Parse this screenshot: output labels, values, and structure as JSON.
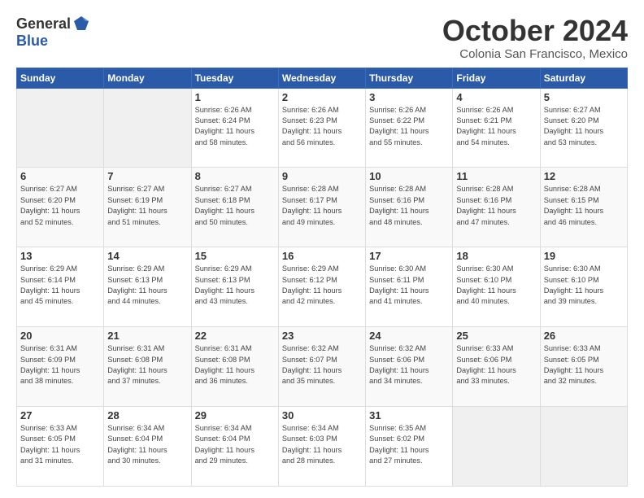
{
  "header": {
    "logo_general": "General",
    "logo_blue": "Blue",
    "month_title": "October 2024",
    "location": "Colonia San Francisco, Mexico"
  },
  "days_of_week": [
    "Sunday",
    "Monday",
    "Tuesday",
    "Wednesday",
    "Thursday",
    "Friday",
    "Saturday"
  ],
  "weeks": [
    [
      {
        "day": "",
        "info": ""
      },
      {
        "day": "",
        "info": ""
      },
      {
        "day": "1",
        "info": "Sunrise: 6:26 AM\nSunset: 6:24 PM\nDaylight: 11 hours\nand 58 minutes."
      },
      {
        "day": "2",
        "info": "Sunrise: 6:26 AM\nSunset: 6:23 PM\nDaylight: 11 hours\nand 56 minutes."
      },
      {
        "day": "3",
        "info": "Sunrise: 6:26 AM\nSunset: 6:22 PM\nDaylight: 11 hours\nand 55 minutes."
      },
      {
        "day": "4",
        "info": "Sunrise: 6:26 AM\nSunset: 6:21 PM\nDaylight: 11 hours\nand 54 minutes."
      },
      {
        "day": "5",
        "info": "Sunrise: 6:27 AM\nSunset: 6:20 PM\nDaylight: 11 hours\nand 53 minutes."
      }
    ],
    [
      {
        "day": "6",
        "info": "Sunrise: 6:27 AM\nSunset: 6:20 PM\nDaylight: 11 hours\nand 52 minutes."
      },
      {
        "day": "7",
        "info": "Sunrise: 6:27 AM\nSunset: 6:19 PM\nDaylight: 11 hours\nand 51 minutes."
      },
      {
        "day": "8",
        "info": "Sunrise: 6:27 AM\nSunset: 6:18 PM\nDaylight: 11 hours\nand 50 minutes."
      },
      {
        "day": "9",
        "info": "Sunrise: 6:28 AM\nSunset: 6:17 PM\nDaylight: 11 hours\nand 49 minutes."
      },
      {
        "day": "10",
        "info": "Sunrise: 6:28 AM\nSunset: 6:16 PM\nDaylight: 11 hours\nand 48 minutes."
      },
      {
        "day": "11",
        "info": "Sunrise: 6:28 AM\nSunset: 6:16 PM\nDaylight: 11 hours\nand 47 minutes."
      },
      {
        "day": "12",
        "info": "Sunrise: 6:28 AM\nSunset: 6:15 PM\nDaylight: 11 hours\nand 46 minutes."
      }
    ],
    [
      {
        "day": "13",
        "info": "Sunrise: 6:29 AM\nSunset: 6:14 PM\nDaylight: 11 hours\nand 45 minutes."
      },
      {
        "day": "14",
        "info": "Sunrise: 6:29 AM\nSunset: 6:13 PM\nDaylight: 11 hours\nand 44 minutes."
      },
      {
        "day": "15",
        "info": "Sunrise: 6:29 AM\nSunset: 6:13 PM\nDaylight: 11 hours\nand 43 minutes."
      },
      {
        "day": "16",
        "info": "Sunrise: 6:29 AM\nSunset: 6:12 PM\nDaylight: 11 hours\nand 42 minutes."
      },
      {
        "day": "17",
        "info": "Sunrise: 6:30 AM\nSunset: 6:11 PM\nDaylight: 11 hours\nand 41 minutes."
      },
      {
        "day": "18",
        "info": "Sunrise: 6:30 AM\nSunset: 6:10 PM\nDaylight: 11 hours\nand 40 minutes."
      },
      {
        "day": "19",
        "info": "Sunrise: 6:30 AM\nSunset: 6:10 PM\nDaylight: 11 hours\nand 39 minutes."
      }
    ],
    [
      {
        "day": "20",
        "info": "Sunrise: 6:31 AM\nSunset: 6:09 PM\nDaylight: 11 hours\nand 38 minutes."
      },
      {
        "day": "21",
        "info": "Sunrise: 6:31 AM\nSunset: 6:08 PM\nDaylight: 11 hours\nand 37 minutes."
      },
      {
        "day": "22",
        "info": "Sunrise: 6:31 AM\nSunset: 6:08 PM\nDaylight: 11 hours\nand 36 minutes."
      },
      {
        "day": "23",
        "info": "Sunrise: 6:32 AM\nSunset: 6:07 PM\nDaylight: 11 hours\nand 35 minutes."
      },
      {
        "day": "24",
        "info": "Sunrise: 6:32 AM\nSunset: 6:06 PM\nDaylight: 11 hours\nand 34 minutes."
      },
      {
        "day": "25",
        "info": "Sunrise: 6:33 AM\nSunset: 6:06 PM\nDaylight: 11 hours\nand 33 minutes."
      },
      {
        "day": "26",
        "info": "Sunrise: 6:33 AM\nSunset: 6:05 PM\nDaylight: 11 hours\nand 32 minutes."
      }
    ],
    [
      {
        "day": "27",
        "info": "Sunrise: 6:33 AM\nSunset: 6:05 PM\nDaylight: 11 hours\nand 31 minutes."
      },
      {
        "day": "28",
        "info": "Sunrise: 6:34 AM\nSunset: 6:04 PM\nDaylight: 11 hours\nand 30 minutes."
      },
      {
        "day": "29",
        "info": "Sunrise: 6:34 AM\nSunset: 6:04 PM\nDaylight: 11 hours\nand 29 minutes."
      },
      {
        "day": "30",
        "info": "Sunrise: 6:34 AM\nSunset: 6:03 PM\nDaylight: 11 hours\nand 28 minutes."
      },
      {
        "day": "31",
        "info": "Sunrise: 6:35 AM\nSunset: 6:02 PM\nDaylight: 11 hours\nand 27 minutes."
      },
      {
        "day": "",
        "info": ""
      },
      {
        "day": "",
        "info": ""
      }
    ]
  ]
}
